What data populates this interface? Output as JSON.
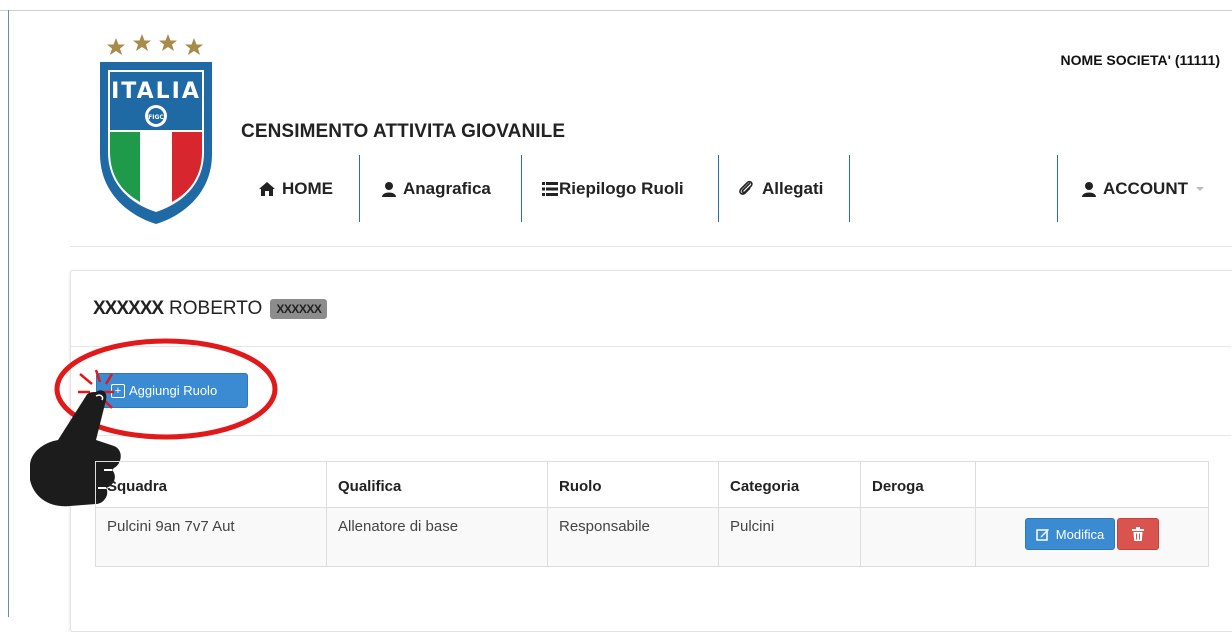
{
  "header": {
    "org_name": "NOME SOCIETA' (11111)",
    "app_title": "CENSIMENTO ATTIVITA GIOVANILE",
    "logo_text": "ITALIA",
    "logo_badge": "FIGC"
  },
  "nav": {
    "home": "HOME",
    "anagrafica": "Anagrafica",
    "riepilogo": "Riepilogo Ruoli",
    "allegati": "Allegati",
    "account": "ACCOUNT"
  },
  "person": {
    "surname": "XXXXXX",
    "given_name": "ROBERTO",
    "code": "XXXXXX"
  },
  "actions": {
    "add_role": "Aggiungi Ruolo"
  },
  "table": {
    "headers": [
      "Squadra",
      "Qualifica",
      "Ruolo",
      "Categoria",
      "Deroga",
      ""
    ],
    "rows": [
      {
        "squadra": "Pulcini 9an 7v7 Aut",
        "qualifica": "Allenatore di base",
        "ruolo": "Responsabile",
        "categoria": "Pulcini",
        "deroga": "",
        "edit_label": "Modifica"
      }
    ]
  },
  "colors": {
    "primary": "#3b8bd3",
    "danger": "#d9534f",
    "nav_separator": "#2a6cb5",
    "highlight": "#e01a1a"
  },
  "icons": [
    "home-icon",
    "user-icon",
    "list-icon",
    "paperclip-icon",
    "pencil-square-icon",
    "trash-icon",
    "plus-icon",
    "pointing-hand-icon"
  ]
}
